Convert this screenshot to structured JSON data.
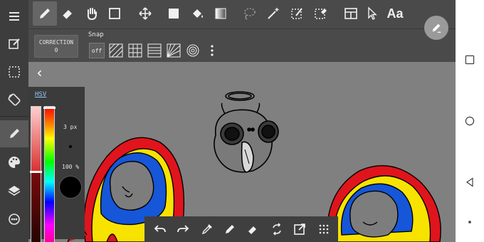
{
  "colors": {
    "canvas": "#808080",
    "toolbar": "#4a4a4a",
    "rail": "#3d3d3d",
    "panel": "#3b3b3b",
    "hsv_label": "#8ec8ff",
    "current_color": "#000000"
  },
  "top_toolbar": {
    "tools": [
      "pen-icon",
      "eraser-icon",
      "hand-icon",
      "rectangle-outline-icon",
      "move-icon",
      "fill-rect-icon",
      "bucket-icon",
      "gradient-icon",
      "lasso-icon",
      "magic-wand-icon",
      "selection-pen-icon",
      "selection-eraser-icon",
      "layout-icon",
      "pointer-icon",
      "text-icon"
    ],
    "text_tool_label": "Aa",
    "active_tool": "pen-icon"
  },
  "snap_bar": {
    "correction_label": "CORRECTION",
    "correction_value": "0",
    "snap_label": "Snap",
    "snap_off_label": "off",
    "snaps": [
      "parallel-snap-icon",
      "cross-snap-icon",
      "grid-snap-icon",
      "curve-snap-icon",
      "perspective-snap-icon",
      "circle-snap-icon",
      "more-vert-icon"
    ]
  },
  "left_rail": {
    "items": [
      "menu-icon",
      "edit-note-icon",
      "selection-icon",
      "rotate-icon",
      "brush-icon",
      "palette-icon",
      "layers-icon",
      "material-icon"
    ],
    "active_item": "brush-icon"
  },
  "color_panel": {
    "mode_label": "HSV",
    "brush_size": "3 px",
    "opacity": "100 %"
  },
  "bottom_toolbar": {
    "tools": [
      "undo-icon",
      "redo-icon",
      "eyedropper-icon",
      "pen-icon",
      "eraser-icon",
      "flip-icon",
      "expand-icon",
      "grid-menu-icon"
    ]
  },
  "nav_bar": {
    "buttons": [
      "recent-apps-icon",
      "home-icon",
      "back-icon",
      "dot-icon"
    ]
  }
}
